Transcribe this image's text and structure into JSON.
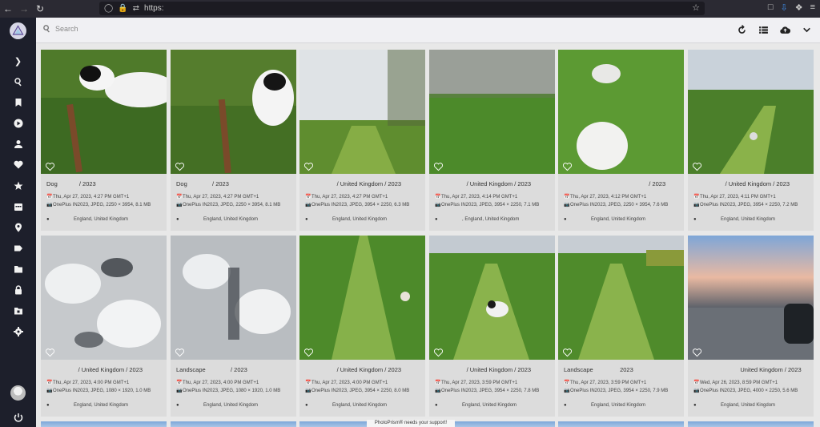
{
  "browser": {
    "url": "https:"
  },
  "search": {
    "placeholder": "Search"
  },
  "support_banner": "PhotoPrism® needs your support!",
  "cards": [
    {
      "title": "Dog",
      "path_sep": " / ",
      "year": "2023",
      "blank_mid": "            ",
      "date": "Thu, Apr 27, 2023, 4:27 PM GMT+1",
      "camera": "OnePlus IN2023, JPEG, 2250 × 3954, 8.1 MB",
      "location": "England, United Kingdom"
    },
    {
      "title": "Dog",
      "path_sep": " / ",
      "year": "2023",
      "blank_mid": "              ",
      "date": "Thu, Apr 27, 2023, 4:27 PM GMT+1",
      "camera": "OnePlus IN2023, JPEG, 2250 × 3954, 8.1 MB",
      "location": "England, United Kingdom"
    },
    {
      "title": "",
      "path_sep": " / United Kingdom / ",
      "year": "2023",
      "blank_mid": "                  ",
      "date": "Thu, Apr 27, 2023, 4:27 PM GMT+1",
      "camera": "OnePlus IN2023, JPEG, 3954 × 2250, 6.3 MB",
      "location": "England, United Kingdom"
    },
    {
      "title": "",
      "path_sep": " / United Kingdom / ",
      "year": "2023",
      "blank_mid": "                  ",
      "date": "Thu, Apr 27, 2023, 4:14 PM GMT+1",
      "camera": "OnePlus IN2023, JPEG, 3954 × 2250, 7.1 MB",
      "location": ", England, United Kingdom"
    },
    {
      "title": "",
      "path_sep": " / ",
      "year": "2023",
      "blank_mid": "                                                  ",
      "date": "Thu, Apr 27, 2023, 4:12 PM GMT+1",
      "camera": "OnePlus IN2023, JPEG, 2250 × 3954, 7.6 MB",
      "location": "England, United Kingdom"
    },
    {
      "title": "",
      "path_sep": " / United Kingdom / ",
      "year": "2023",
      "blank_mid": "                  ",
      "date": "Thu, Apr 27, 2023, 4:11 PM GMT+1",
      "camera": "OnePlus IN2023, JPEG, 3954 × 2250, 7.2 MB",
      "location": "England, United Kingdom"
    },
    {
      "title": "",
      "path_sep": " / United Kingdom / ",
      "year": "2023",
      "blank_mid": "                  ",
      "date": "Thu, Apr 27, 2023, 4:00 PM GMT+1",
      "camera": "OnePlus IN2023, JPEG, 1080 × 1920, 1.0 MB",
      "location": "England, United Kingdom"
    },
    {
      "title": "Landscape",
      "path_sep": " / ",
      "year": "2023",
      "blank_mid": "              ",
      "date": "Thu, Apr 27, 2023, 4:00 PM GMT+1",
      "camera": "OnePlus IN2023, JPEG, 1080 × 1920, 1.0 MB",
      "location": "England, United Kingdom"
    },
    {
      "title": "",
      "path_sep": " / United Kingdom / ",
      "year": "2023",
      "blank_mid": "                  ",
      "date": "Thu, Apr 27, 2023, 4:00 PM GMT+1",
      "camera": "OnePlus IN2023, JPEG, 3954 × 2250, 8.0 MB",
      "location": "England, United Kingdom"
    },
    {
      "title": "",
      "path_sep": " / United Kingdom / ",
      "year": "2023",
      "blank_mid": "                  ",
      "date": "Thu, Apr 27, 2023, 3:59 PM GMT+1",
      "camera": "OnePlus IN2023, JPEG, 3954 × 2250, 7.8 MB",
      "location": "England, United Kingdom"
    },
    {
      "title": "Landscape",
      "path_sep": " ",
      "year": "2023",
      "blank_mid": "               ",
      "date": "Thu, Apr 27, 2023, 3:59 PM GMT+1",
      "camera": "OnePlus IN2023, JPEG, 3954 × 2250, 7.9 MB",
      "location": "England, United Kingdom"
    },
    {
      "title": "",
      "path_sep": "United Kingdom / ",
      "year": "2023",
      "blank_mid": "                            ",
      "date": "Wed, Apr 26, 2023, 8:59 PM GMT+1",
      "camera": "OnePlus IN2023, JPEG, 4000 × 2250, 5.6 MB",
      "location": "England, United Kingdom"
    }
  ]
}
